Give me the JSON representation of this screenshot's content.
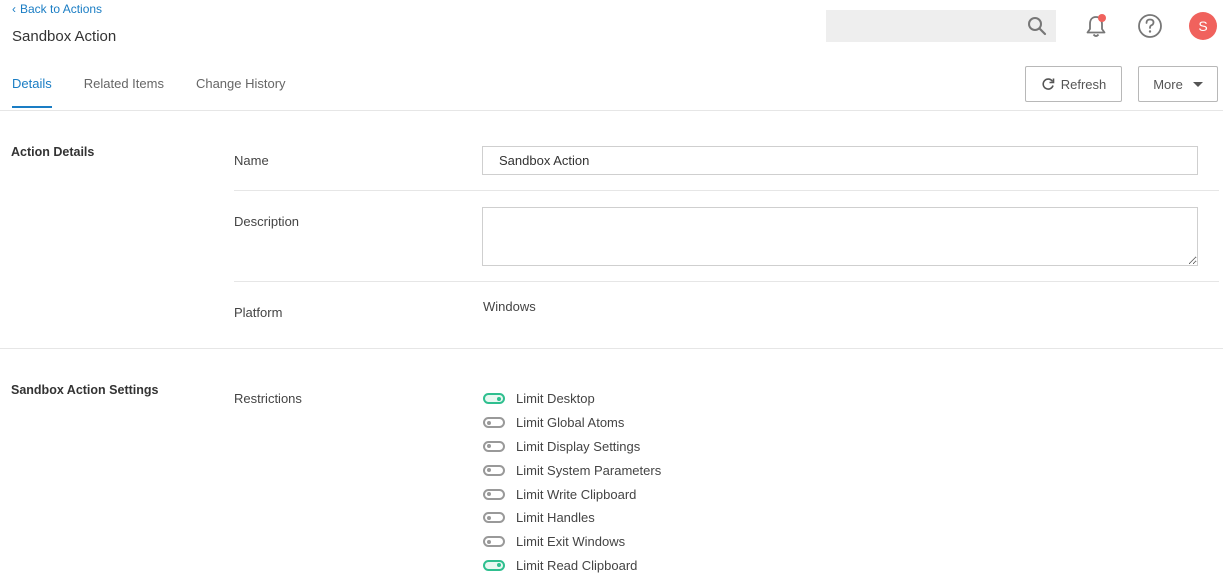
{
  "header": {
    "back_label": "Back to Actions",
    "title": "Sandbox Action",
    "search_placeholder": "",
    "avatar_initial": "S"
  },
  "tabs": [
    {
      "label": "Details",
      "active": true
    },
    {
      "label": "Related Items",
      "active": false
    },
    {
      "label": "Change History",
      "active": false
    }
  ],
  "toolbar": {
    "refresh_label": "Refresh",
    "more_label": "More"
  },
  "action_details": {
    "section_title": "Action Details",
    "name_label": "Name",
    "name_value": "Sandbox Action",
    "description_label": "Description",
    "description_value": "",
    "platform_label": "Platform",
    "platform_value": "Windows"
  },
  "settings": {
    "section_title": "Sandbox Action Settings",
    "restrictions_label": "Restrictions",
    "restrictions": [
      {
        "label": "Limit Desktop",
        "on": true
      },
      {
        "label": "Limit Global Atoms",
        "on": false
      },
      {
        "label": "Limit Display Settings",
        "on": false
      },
      {
        "label": "Limit System Parameters",
        "on": false
      },
      {
        "label": "Limit Write Clipboard",
        "on": false
      },
      {
        "label": "Limit Handles",
        "on": false
      },
      {
        "label": "Limit Exit Windows",
        "on": false
      },
      {
        "label": "Limit Read Clipboard",
        "on": true
      }
    ]
  },
  "colors": {
    "accent": "#1a7dc4",
    "toggle_on": "#2fbf8f",
    "avatar_bg": "#f0625d",
    "notification_dot": "#f0625d"
  }
}
